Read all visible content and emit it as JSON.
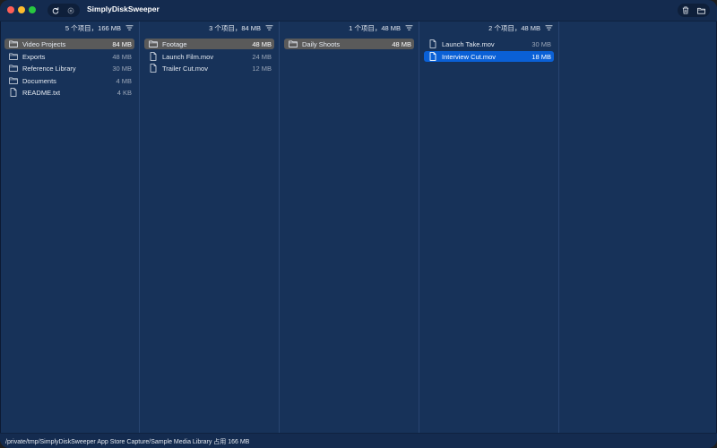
{
  "app": {
    "title": "SimplyDiskSweeper"
  },
  "columns": [
    {
      "summary": "5 个项目，166 MB",
      "rows": [
        {
          "name": "Video Projects",
          "size": "84 MB",
          "icon": "folder-icon",
          "selected": "gray"
        },
        {
          "name": "Exports",
          "size": "48 MB",
          "icon": "folder-icon"
        },
        {
          "name": "Reference Library",
          "size": "30 MB",
          "icon": "folder-icon"
        },
        {
          "name": "Documents",
          "size": "4 MB",
          "icon": "folder-icon"
        },
        {
          "name": "README.txt",
          "size": "4 KB",
          "icon": "file-icon"
        }
      ]
    },
    {
      "summary": "3 个项目，84 MB",
      "rows": [
        {
          "name": "Footage",
          "size": "48 MB",
          "icon": "folder-icon",
          "selected": "gray"
        },
        {
          "name": "Launch Film.mov",
          "size": "24 MB",
          "icon": "file-icon"
        },
        {
          "name": "Trailer Cut.mov",
          "size": "12 MB",
          "icon": "file-icon"
        }
      ]
    },
    {
      "summary": "1 个项目，48 MB",
      "rows": [
        {
          "name": "Daily Shoots",
          "size": "48 MB",
          "icon": "folder-icon",
          "selected": "gray"
        }
      ]
    },
    {
      "summary": "2 个项目，48 MB",
      "rows": [
        {
          "name": "Launch Take.mov",
          "size": "30 MB",
          "icon": "file-icon"
        },
        {
          "name": "Interview Cut.mov",
          "size": "18 MB",
          "icon": "file-icon",
          "selected": "blue"
        }
      ]
    },
    {
      "summary": "",
      "rows": []
    }
  ],
  "status": {
    "text": "/private/tmp/SimplyDiskSweeper App Store Capture/Sample Media Library 占用 166 MB"
  },
  "colors": {
    "background": "#173259",
    "selection_blue": "#0a60d6",
    "selection_gray": "#5a5a5a"
  }
}
